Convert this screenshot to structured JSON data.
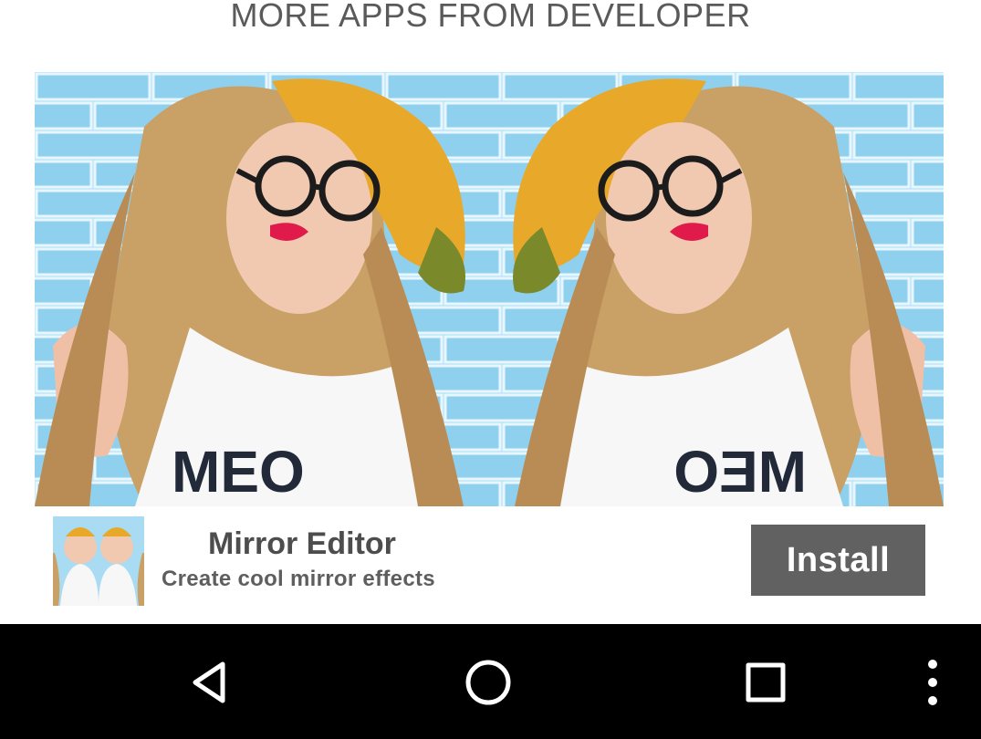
{
  "header": {
    "title": "MORE APPS FROM DEVELOPER"
  },
  "ad": {
    "banner_icon": "mirror-selfie-photo",
    "app_name": "Mirror Editor",
    "app_description": "Create cool mirror effects",
    "install_label": "Install",
    "colors": {
      "install_bg": "#616161",
      "brick_wall": "#a9dcf3",
      "hat": "#e8a82a"
    }
  },
  "nav_bar": {
    "icons": [
      "back-icon",
      "home-icon",
      "recents-icon",
      "overflow-menu-icon"
    ]
  }
}
